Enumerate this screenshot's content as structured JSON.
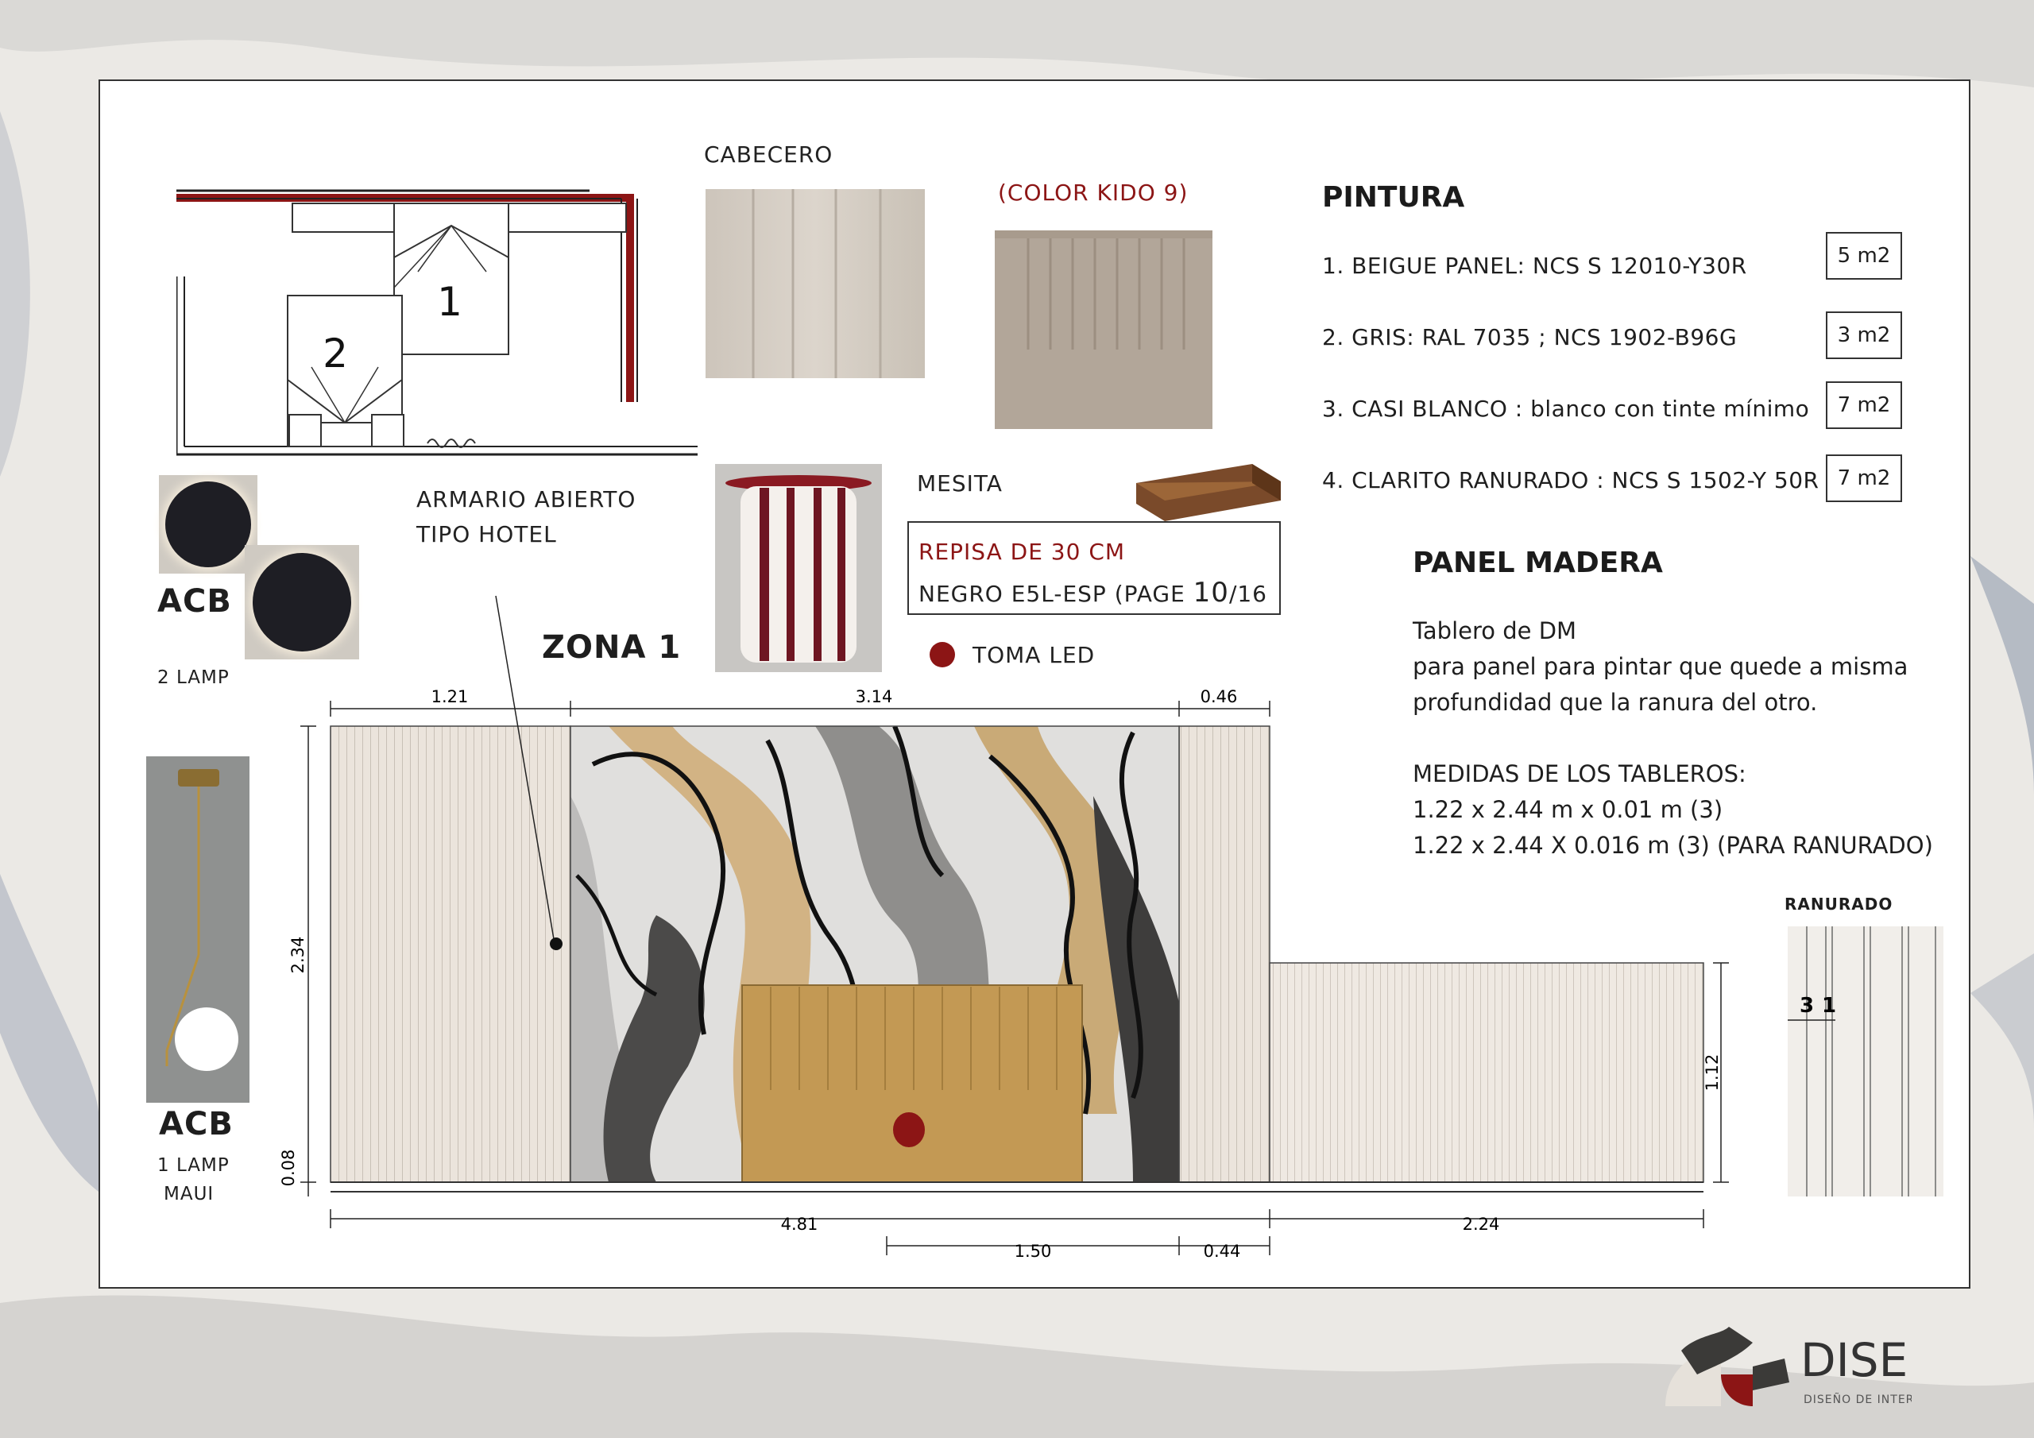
{
  "floorplan": {
    "bed1_label": "1",
    "bed2_label": "2"
  },
  "cabecero": {
    "title": "CABECERO",
    "color_note": "(COLOR KIDO 9)"
  },
  "armario": {
    "line1": "ARMARIO ABIERTO",
    "line2": "TIPO HOTEL"
  },
  "lamp_wall": {
    "brand": "ACB",
    "desc": "2 LAMP"
  },
  "lamp_pendant": {
    "brand": "ACB",
    "desc1": "1 LAMP",
    "desc2": "MAUI"
  },
  "zone_title": "ZONA 1",
  "mesita": {
    "title": "MESITA",
    "shelf_line1": "REPISA DE 30 CM",
    "shelf_line2": "NEGRO   E5L-ESP (PAGE ",
    "page_num": "10",
    "page_total": "/16",
    "toma": "TOMA LED"
  },
  "pintura": {
    "title": "PINTURA",
    "items": [
      {
        "text": "1. BEIGUE PANEL: NCS S 12010-Y30R",
        "qty": "5 m2"
      },
      {
        "text": "2. GRIS: RAL 7035 ;  NCS  1902-B96G",
        "qty": "3 m2"
      },
      {
        "text": "3. CASI BLANCO  : blanco con tinte mínimo",
        "qty": "7 m2"
      },
      {
        "text": "4. CLARITO RANURADO :  NCS S 1502-Y 50R",
        "qty": "7 m2"
      }
    ]
  },
  "panel_madera": {
    "title": "PANEL MADERA",
    "l1": "Tablero de DM",
    "l2": "para panel para pintar que quede a misma",
    "l3": "profundidad que la ranura del otro.",
    "l4": "MEDIDAS DE LOS TABLEROS:",
    "l5": "1.22 x 2.44 m x 0.01 m (3)",
    "l6": "1.22 x 2.44 X 0.016 m (3) (PARA RANURADO)"
  },
  "ranurado": {
    "title": "RANURADO",
    "dim_a": "3",
    "dim_b": "1"
  },
  "dimensions": {
    "top_left": "1.21",
    "top_mid": "3.14",
    "top_right": "0.46",
    "height_total": "2.34",
    "height_base": "0.08",
    "height_right": "1.12",
    "bottom_main": "4.81",
    "bottom_right": "2.24",
    "bottom_headboard": "1.50",
    "bottom_small": "0.44"
  },
  "logo": {
    "name": "DISEDRA",
    "tagline": "DISEÑO DE INTERIORES"
  },
  "colors": {
    "accent_red": "#8c1515",
    "panel_beige": "#e9e2da",
    "headboard_gold": "#c49a55"
  }
}
